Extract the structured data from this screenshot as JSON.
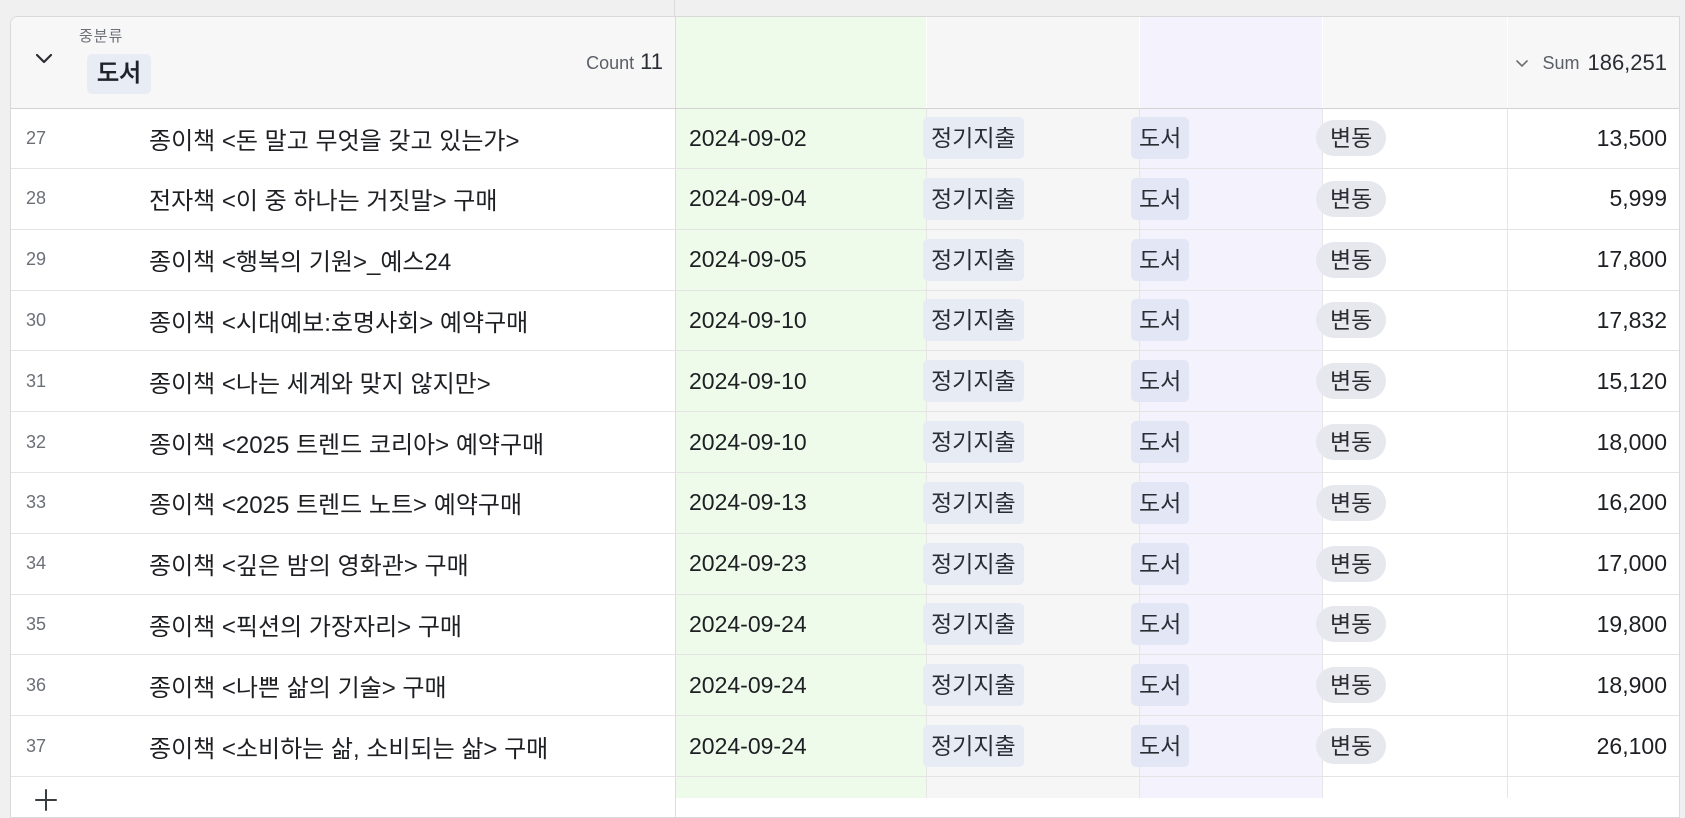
{
  "group": {
    "field_label": "중분류",
    "value": "도서",
    "count_label": "Count",
    "count_value": "11",
    "sum_label": "Sum",
    "sum_value": "186,251"
  },
  "colors": {
    "date_column_bg": "#eefaea",
    "category_column_bg": "#f4f3fd",
    "chip_bg": "#e7ebf4"
  },
  "rows": [
    {
      "num": "27",
      "title": "종이책 <돈 말고 무엇을 갖고 있는가>",
      "date": "2024-09-02",
      "type": "정기지출",
      "category": "도서",
      "kind": "변동",
      "amount": "13,500"
    },
    {
      "num": "28",
      "title": "전자책 <이 중 하나는 거짓말> 구매",
      "date": "2024-09-04",
      "type": "정기지출",
      "category": "도서",
      "kind": "변동",
      "amount": "5,999"
    },
    {
      "num": "29",
      "title": "종이책 <행복의 기원>_예스24",
      "date": "2024-09-05",
      "type": "정기지출",
      "category": "도서",
      "kind": "변동",
      "amount": "17,800"
    },
    {
      "num": "30",
      "title": "종이책 <시대예보:호명사회> 예약구매",
      "date": "2024-09-10",
      "type": "정기지출",
      "category": "도서",
      "kind": "변동",
      "amount": "17,832"
    },
    {
      "num": "31",
      "title": "종이책 <나는 세계와 맞지 않지만>",
      "date": "2024-09-10",
      "type": "정기지출",
      "category": "도서",
      "kind": "변동",
      "amount": "15,120"
    },
    {
      "num": "32",
      "title": "종이책 <2025 트렌드 코리아> 예약구매",
      "date": "2024-09-10",
      "type": "정기지출",
      "category": "도서",
      "kind": "변동",
      "amount": "18,000"
    },
    {
      "num": "33",
      "title": "종이책 <2025 트렌드 노트> 예약구매",
      "date": "2024-09-13",
      "type": "정기지출",
      "category": "도서",
      "kind": "변동",
      "amount": "16,200"
    },
    {
      "num": "34",
      "title": "종이책 <깊은 밤의 영화관> 구매",
      "date": "2024-09-23",
      "type": "정기지출",
      "category": "도서",
      "kind": "변동",
      "amount": "17,000"
    },
    {
      "num": "35",
      "title": "종이책 <픽션의 가장자리> 구매",
      "date": "2024-09-24",
      "type": "정기지출",
      "category": "도서",
      "kind": "변동",
      "amount": "19,800"
    },
    {
      "num": "36",
      "title": "종이책 <나쁜 삶의 기술> 구매",
      "date": "2024-09-24",
      "type": "정기지출",
      "category": "도서",
      "kind": "변동",
      "amount": "18,900"
    },
    {
      "num": "37",
      "title": "종이책 <소비하는 삶, 소비되는 삶> 구매",
      "date": "2024-09-24",
      "type": "정기지출",
      "category": "도서",
      "kind": "변동",
      "amount": "26,100"
    }
  ]
}
